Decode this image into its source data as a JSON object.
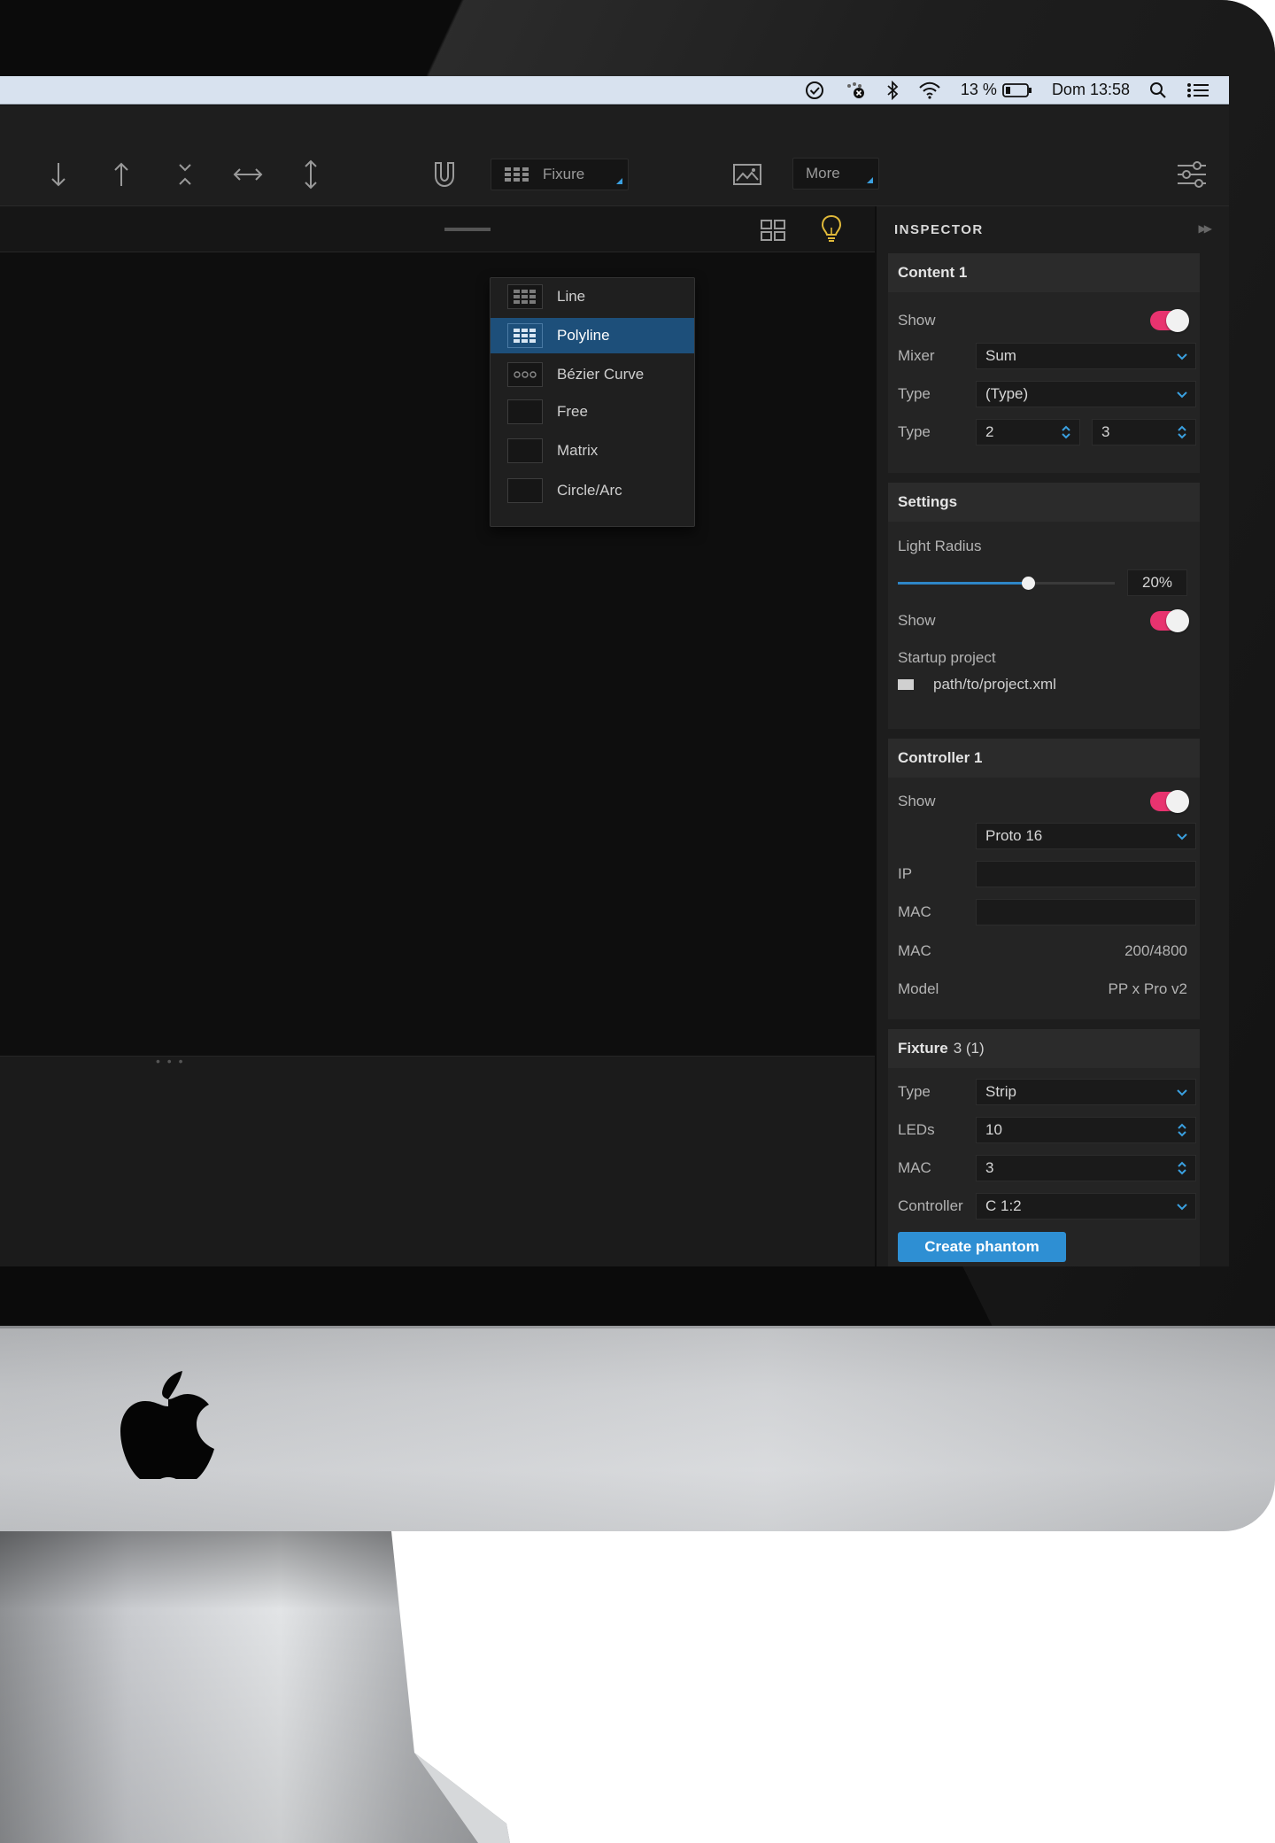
{
  "menubar": {
    "battery": "13 %",
    "clock": "Dom 13:58"
  },
  "toolbar": {
    "fixture_label": "Fixure",
    "more_label": "More"
  },
  "fixture_menu": {
    "items": [
      {
        "label": "Line",
        "icon": "grid-icon",
        "selected": false
      },
      {
        "label": "Polyline",
        "icon": "grid-icon",
        "selected": true
      },
      {
        "label": "Bézier Curve",
        "icon": "dots-icon",
        "selected": false
      },
      {
        "label": "Free",
        "icon": "blank-icon",
        "selected": false
      },
      {
        "label": "Matrix",
        "icon": "blank-icon",
        "selected": false
      },
      {
        "label": "Circle/Arc",
        "icon": "blank-icon",
        "selected": false
      }
    ]
  },
  "inspector": {
    "title": "INSPECTOR",
    "content": {
      "title": "Content 1",
      "show_label": "Show",
      "show_on": true,
      "mixer_label": "Mixer",
      "mixer_value": "Sum",
      "type_label": "Type",
      "type_value": "(Type)",
      "type2_label": "Type",
      "type2_a": "2",
      "type2_b": "3"
    },
    "settings": {
      "title": "Settings",
      "radius_label": "Light Radius",
      "radius_value": "20%",
      "radius_fraction": 0.6,
      "show_label": "Show",
      "show_on": true,
      "startup_label": "Startup project",
      "startup_path": "path/to/project.xml"
    },
    "controller": {
      "title": "Controller 1",
      "show_label": "Show",
      "show_on": true,
      "model_select": "Proto 16",
      "ip_label": "IP",
      "ip_value": "",
      "mac_label": "MAC",
      "mac_value": "",
      "mac2_label": "MAC",
      "mac2_value": "200/4800",
      "model_label": "Model",
      "model_value": "PP x Pro v2"
    },
    "fixture": {
      "title": "Fixture",
      "title_suffix": "3 (1)",
      "type_label": "Type",
      "type_value": "Strip",
      "leds_label": "LEDs",
      "leds_value": "10",
      "mac_label": "MAC",
      "mac_value": "3",
      "controller_label": "Controller",
      "controller_value": "C 1:2",
      "create_button": "Create phantom"
    }
  },
  "colors": {
    "accent": "#2e8fd3",
    "toggle_on": "#e8336f",
    "menu_selected": "#1d4f7a"
  }
}
